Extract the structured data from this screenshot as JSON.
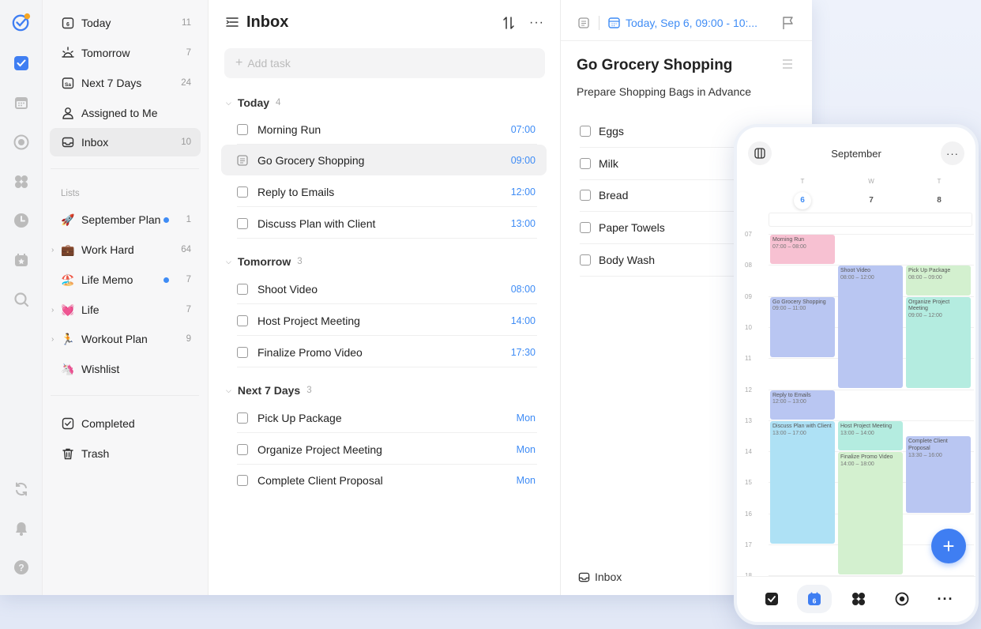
{
  "sidebar": {
    "smart": [
      {
        "label": "Today",
        "count": "11"
      },
      {
        "label": "Tomorrow",
        "count": "7"
      },
      {
        "label": "Next 7 Days",
        "count": "24"
      },
      {
        "label": "Assigned to Me",
        "count": ""
      },
      {
        "label": "Inbox",
        "count": "10"
      }
    ],
    "lists_heading": "Lists",
    "lists": [
      {
        "emoji": "🚀",
        "label": "September Plan",
        "count": "1"
      },
      {
        "emoji": "💼",
        "label": "Work Hard",
        "count": "64"
      },
      {
        "emoji": "🏖️",
        "label": "Life Memo",
        "count": "7"
      },
      {
        "emoji": "💓",
        "label": "Life",
        "count": "7"
      },
      {
        "emoji": "🏃",
        "label": "Workout Plan",
        "count": "9"
      },
      {
        "emoji": "🦄",
        "label": "Wishlist",
        "count": ""
      }
    ],
    "bottom": [
      {
        "label": "Completed"
      },
      {
        "label": "Trash"
      }
    ]
  },
  "inbox": {
    "title": "Inbox",
    "add_placeholder": "Add task",
    "sections": [
      {
        "name": "Today",
        "count": "4",
        "tasks": [
          {
            "title": "Morning Run",
            "time": "07:00"
          },
          {
            "title": "Go Grocery Shopping",
            "time": "09:00"
          },
          {
            "title": "Reply to Emails",
            "time": "12:00"
          },
          {
            "title": "Discuss Plan with Client",
            "time": "13:00"
          }
        ]
      },
      {
        "name": "Tomorrow",
        "count": "3",
        "tasks": [
          {
            "title": "Shoot Video",
            "time": "08:00"
          },
          {
            "title": "Host Project Meeting",
            "time": "14:00"
          },
          {
            "title": "Finalize Promo Video",
            "time": "17:30"
          }
        ]
      },
      {
        "name": "Next 7 Days",
        "count": "3",
        "tasks": [
          {
            "title": "Pick Up Package",
            "time": "Mon"
          },
          {
            "title": "Organize Project Meeting",
            "time": "Mon"
          },
          {
            "title": "Complete Client Proposal",
            "time": "Mon"
          }
        ]
      }
    ]
  },
  "detail": {
    "date": "Today, Sep 6, 09:00 - 10:...",
    "title": "Go Grocery Shopping",
    "description": "Prepare Shopping Bags in Advance",
    "checklist": [
      "Eggs",
      "Milk",
      "Bread",
      "Paper Towels",
      "Body Wash"
    ],
    "list_name": "Inbox"
  },
  "phone": {
    "month": "September",
    "days": [
      {
        "dow": "T",
        "num": "6"
      },
      {
        "dow": "W",
        "num": "7"
      },
      {
        "dow": "T",
        "num": "8"
      }
    ],
    "hours": [
      "07",
      "08",
      "09",
      "10",
      "11",
      "12",
      "13",
      "14",
      "15",
      "16",
      "17",
      "18"
    ],
    "events": [
      {
        "title": "Morning Run",
        "time": "07:00 – 08:00",
        "color": "#f7c1d2"
      },
      {
        "title": "Go Grocery Shopping",
        "time": "09:00 – 11:00",
        "color": "#b9c6f2"
      },
      {
        "title": "Reply to Emails",
        "time": "12:00 – 13:00",
        "color": "#b9c6f2"
      },
      {
        "title": "Discuss Plan with Client",
        "time": "13:00 – 17:00",
        "color": "#aee1f5"
      },
      {
        "title": "Shoot Video",
        "time": "08:00 – 12:00",
        "color": "#b9c6f2"
      },
      {
        "title": "Host Project Meeting",
        "time": "13:00 – 14:00",
        "color": "#b4ece0"
      },
      {
        "title": "Finalize Promo Video",
        "time": "14:00 – 18:00",
        "color": "#d3f0cf"
      },
      {
        "title": "Pick Up Package",
        "time": "08:00 – 09:00",
        "color": "#d3f0cf"
      },
      {
        "title": "Organize Project Meeting",
        "time": "09:00 – 12:00",
        "color": "#b4ece0"
      },
      {
        "title": "Complete Client Proposal",
        "time": "13:30 – 16:00",
        "color": "#b9c6f2"
      }
    ],
    "today_badge": "6"
  },
  "colors": {
    "accent": "#3f8cf5",
    "brand": "#3f7ef2"
  }
}
